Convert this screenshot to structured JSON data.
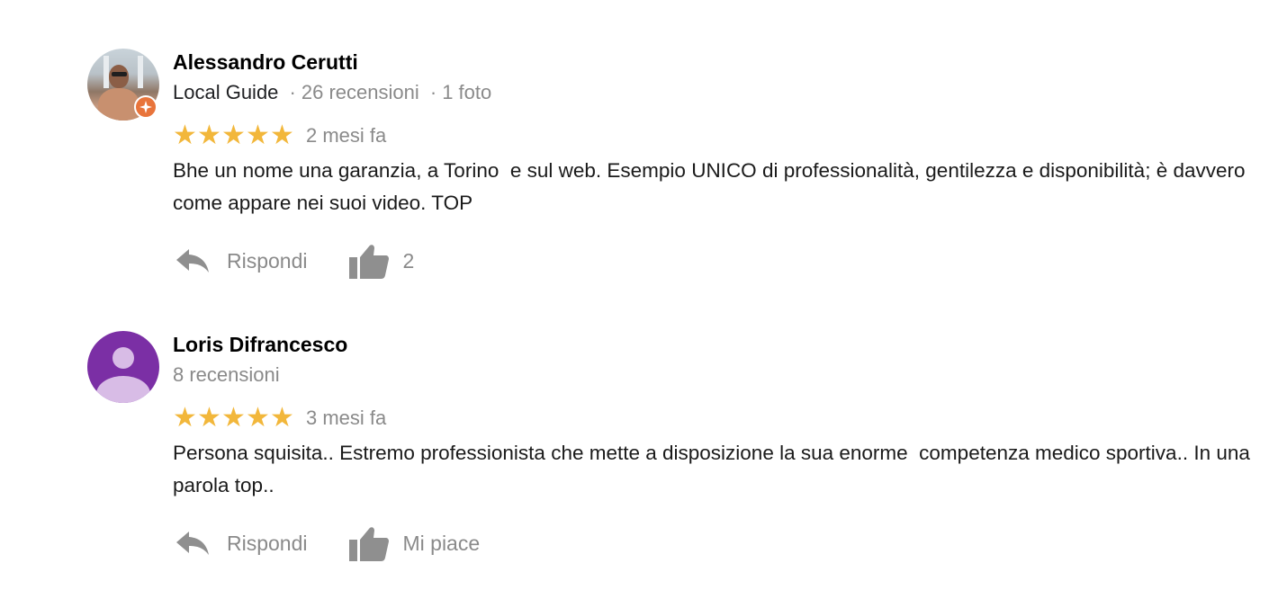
{
  "reviews": [
    {
      "author": "Alessandro Cerutti",
      "badge": "Local Guide",
      "review_count": "26 recensioni",
      "photo_count": "1 foto",
      "separator": "·",
      "rating": 5,
      "stars": [
        "★",
        "★",
        "★",
        "★",
        "★"
      ],
      "time": "2 mesi fa",
      "text": "Bhe un nome una garanzia, a Torino  e sul web. Esempio UNICO di professionalità, gentilezza e disponibilità; è davvero come appare nei suoi video. TOP",
      "reply_label": "Rispondi",
      "like_label": "2",
      "avatar_icon": "user-photo-avatar",
      "badge_icon": "local-guide-star-icon"
    },
    {
      "author": "Loris Difrancesco",
      "review_count": "8 recensioni",
      "rating": 5,
      "stars": [
        "★",
        "★",
        "★",
        "★",
        "★"
      ],
      "time": "3 mesi fa",
      "text": "Persona squisita.. Estremo professionista che mette a disposizione la sua enorme  competenza medico sportiva.. In una parola top..",
      "reply_label": "Rispondi",
      "like_label": "Mi piace",
      "avatar_icon": "default-person-avatar"
    }
  ],
  "colors": {
    "star": "#f2b73b",
    "meta_text": "#8a8a8a",
    "icon_gray": "#8f8f8f",
    "guide_badge": "#e8743b",
    "default_avatar_bg": "#7b2fa5",
    "default_avatar_fg": "#d8bce6"
  }
}
